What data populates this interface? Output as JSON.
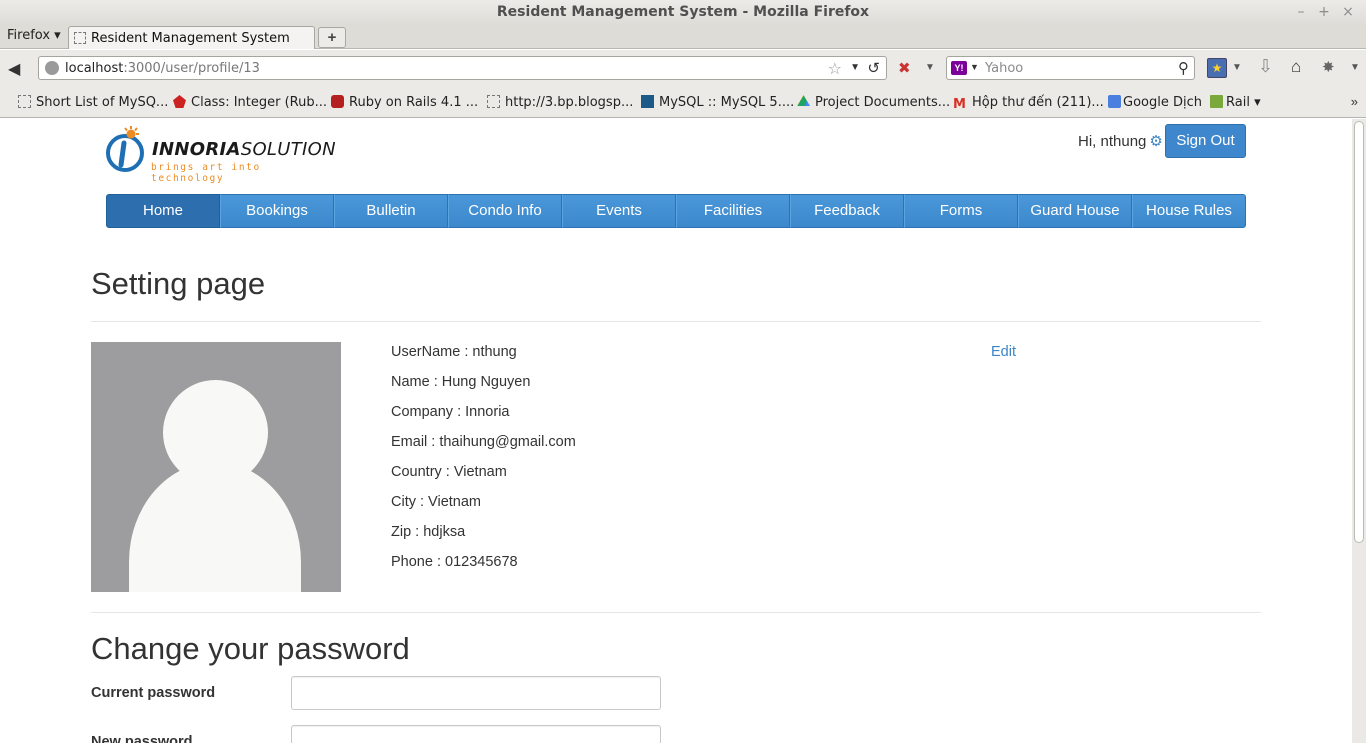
{
  "window": {
    "title": "Resident Management System - Mozilla Firefox",
    "minimize_label": "–",
    "maximize_label": "+",
    "close_label": "×"
  },
  "browser": {
    "menu_label": "Firefox ▾",
    "tab_label": "Resident Management System",
    "new_tab_label": "+",
    "url_host": "localhost",
    "url_path": ":3000/user/profile/13",
    "search_placeholder": "Yahoo",
    "search_engine_badge": "Y!",
    "bookmarks": [
      {
        "label": "Short List of MySQ...",
        "icon": "blank-page-icon",
        "color": "#ffffff"
      },
      {
        "label": "Class: Integer (Rub...",
        "icon": "ruby-icon",
        "color": "#cc2222"
      },
      {
        "label": "Ruby on Rails 4.1 ...",
        "icon": "rails-icon",
        "color": "#b41f1f"
      },
      {
        "label": "http://3.bp.blogsp...",
        "icon": "blank-page-icon",
        "color": "#ffffff"
      },
      {
        "label": "MySQL :: MySQL 5....",
        "icon": "mysql-icon",
        "color": "#1d5a8a"
      },
      {
        "label": "Project Documents...",
        "icon": "drive-icon",
        "color": "#f2b01e"
      },
      {
        "label": "Hộp thư đến (211)...",
        "icon": "gmail-icon",
        "color": "#d93025"
      },
      {
        "label": "Google Dịch",
        "icon": "translate-icon",
        "color": "#4a7fe0"
      },
      {
        "label": "Rail ▾",
        "icon": "folder-icon",
        "color": "#7aa83a"
      }
    ]
  },
  "header": {
    "logo_bold": "INNORIA",
    "logo_light": "SOLUTION",
    "logo_tagline": "brings art into technology",
    "greeting": "Hi, nthung",
    "sign_out": "Sign Out"
  },
  "nav": {
    "items": [
      "Home",
      "Bookings",
      "Bulletin",
      "Condo Info",
      "Events",
      "Facilities",
      "Feedback",
      "Forms",
      "Guard House",
      "House Rules"
    ],
    "active": "Home"
  },
  "profile": {
    "title": "Setting page",
    "edit": "Edit",
    "fields": [
      "UserName : nthung",
      "Name : Hung Nguyen",
      "Company : Innoria",
      "Email : thaihung@gmail.com",
      "Country : Vietnam",
      "City : Vietnam",
      "Zip : hdjksa",
      "Phone : 012345678"
    ]
  },
  "password": {
    "title": "Change your password",
    "current_label": "Current password",
    "new_label": "New password",
    "current_value": "",
    "new_value": ""
  },
  "colors": {
    "primary": "#3f87cd",
    "nav_active": "#2c6eae",
    "link": "#3c85c6",
    "logo_orange": "#ee8c24"
  }
}
